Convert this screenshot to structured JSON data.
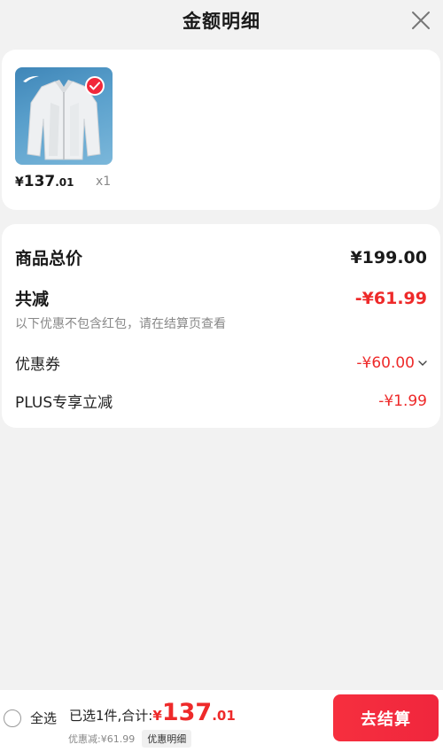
{
  "header": {
    "title": "金额明细",
    "close_icon": "close-icon"
  },
  "product": {
    "image_icon": "jacket-image",
    "selected": true,
    "price_symbol": "¥",
    "price_int": "137",
    "price_dec": ".01",
    "quantity": "x1"
  },
  "summary": {
    "total_label": "商品总价",
    "total_value": "¥199.00",
    "reduce_label": "共减",
    "reduce_value": "-¥61.99",
    "note": "以下优惠不包含红包，请在结算页查看",
    "coupon_label": "优惠券",
    "coupon_value": "-¥60.00",
    "plus_label": "PLUS专享立减",
    "plus_value": "-¥1.99"
  },
  "bottom": {
    "select_all": "全选",
    "selected_text": "已选1件,合计:",
    "sum_symbol": "¥",
    "sum_int": "137",
    "sum_dec": ".01",
    "discount_text": "优惠减:¥61.99",
    "detail_tag": "优惠明细",
    "checkout": "去结算"
  },
  "colors": {
    "accent_red": "#ee2a2a",
    "button_red": "#f62f3e",
    "page_bg": "#f2f2f2"
  }
}
